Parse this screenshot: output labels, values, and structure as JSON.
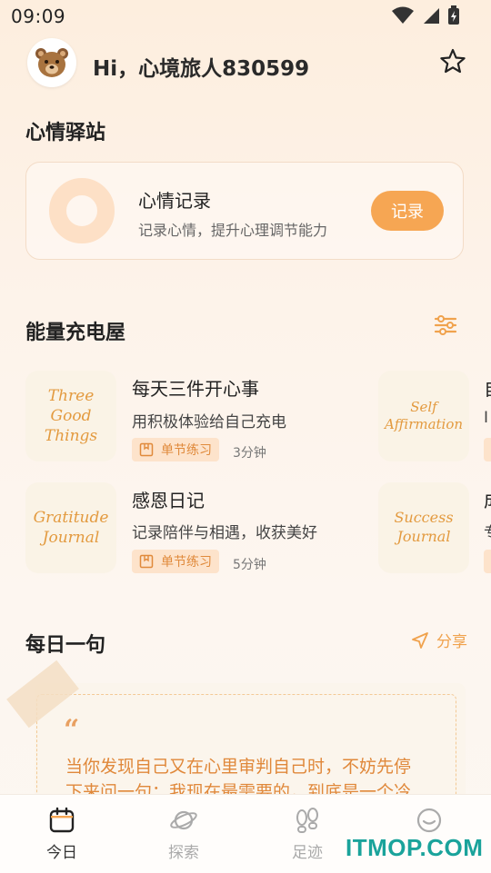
{
  "status_bar": {
    "time": "09:09"
  },
  "header": {
    "greeting": "Hi，心境旅人830599"
  },
  "mood_station": {
    "title": "心情驿站",
    "card_title": "心情记录",
    "card_desc": "记录心情，提升心理调节能力",
    "button_label": "记录"
  },
  "energy_room": {
    "title": "能量充电屋",
    "items": [
      {
        "thumb": [
          "Three",
          "Good",
          "Things"
        ],
        "title": "每天三件开心事",
        "desc": "用积极体验给自己充电",
        "tag": "单节练习",
        "duration": "3分钟"
      },
      {
        "thumb": [
          "Gratitude",
          "Journal"
        ],
        "title": "感恩日记",
        "desc": "记录陪伴与相遇，收获美好",
        "tag": "单节练习",
        "duration": "5分钟"
      }
    ],
    "side_items": [
      {
        "thumb": [
          "Self",
          "Affirmation"
        ],
        "title_partial": "自",
        "desc_partial": "I"
      },
      {
        "thumb": [
          "Success",
          "Journal"
        ],
        "title_partial": "成",
        "desc_partial": "专"
      }
    ]
  },
  "daily_quote": {
    "title": "每日一句",
    "share_label": "分享",
    "quote_mark": "“",
    "text_line1": "当你发现自己又在心里审判自己时，不妨先停",
    "text_line2": "下来问一句：我现在最需要的，到底是一个冷"
  },
  "bottom_nav": {
    "items": [
      {
        "label": "今日",
        "icon": "calendar-icon",
        "active": true
      },
      {
        "label": "探索",
        "icon": "planet-icon",
        "active": false
      },
      {
        "label": "足迹",
        "icon": "footprint-icon",
        "active": false
      },
      {
        "label": "",
        "icon": "smile-icon",
        "active": false
      }
    ]
  },
  "watermark": "ITMOP.COM",
  "colors": {
    "accent": "#f6a653",
    "tag_bg": "#fde3cb",
    "quote_text": "#e0883a",
    "watermark": "#1aa39b"
  }
}
